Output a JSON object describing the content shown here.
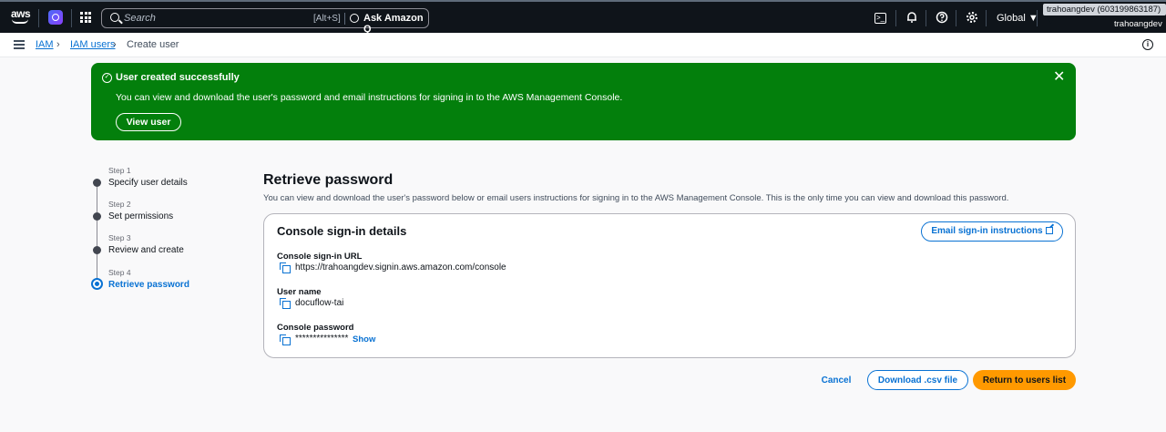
{
  "topnav": {
    "logo_text": "aws",
    "search_placeholder": "Search",
    "search_shortcut": "[Alt+S]",
    "ask_q_label": "Ask Amazon Q",
    "region": "Global ▼",
    "account_id": "trahoangdev (603199863187) ▼",
    "account_name": "trahoangdev",
    "icons": [
      "cloudshell-icon",
      "bell-icon",
      "help-icon",
      "gear-icon"
    ]
  },
  "breadcrumb": {
    "items": [
      "IAM",
      "IAM users",
      "Create user"
    ],
    "separator": "›"
  },
  "flash": {
    "title": "User created successfully",
    "message": "You can view and download the user's password and email instructions for signing in to the AWS Management Console.",
    "button_label": "View user",
    "close_glyph": "✕",
    "color": "#037f0c"
  },
  "steps": [
    {
      "step": "Step 1",
      "label": "Specify user details"
    },
    {
      "step": "Step 2",
      "label": "Set permissions"
    },
    {
      "step": "Step 3",
      "label": "Review and create"
    },
    {
      "step": "Step 4",
      "label": "Retrieve password",
      "active": true
    }
  ],
  "main": {
    "title": "Retrieve password",
    "description": "You can view and download the user's password below or email users instructions for signing in to the AWS Management Console. This is the only time you can view and download this password.",
    "card": {
      "title": "Console sign-in details",
      "email_button": "Email sign-in instructions",
      "fields": [
        {
          "label": "Console sign-in URL",
          "value": "https://trahoangdev.signin.aws.amazon.com/console"
        },
        {
          "label": "User name",
          "value": "docuflow-tai"
        },
        {
          "label": "Console password",
          "value": "***************",
          "action": "Show"
        }
      ]
    }
  },
  "footer": {
    "cancel": "Cancel",
    "download_csv": "Download .csv file",
    "return": "Return to users list"
  },
  "colors": {
    "primary": "#0972d3",
    "accent": "#ff9900",
    "nav_bg": "#0f141a"
  }
}
